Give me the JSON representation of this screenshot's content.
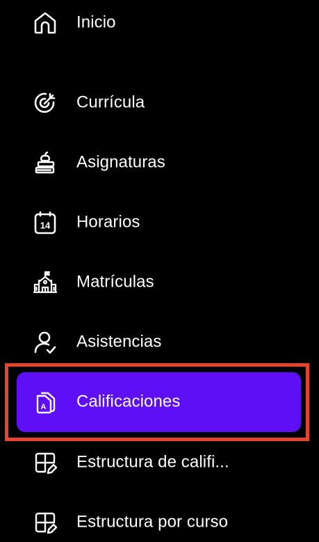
{
  "colors": {
    "background": "#000000",
    "active_item_bg": "#5f0ff5",
    "text": "#ffffff",
    "highlight_border": "#e8432c"
  },
  "sidebar": {
    "items": [
      {
        "label": "Inicio",
        "icon": "home-icon",
        "active": false
      },
      {
        "label": "Currícula",
        "icon": "target-icon",
        "active": false
      },
      {
        "label": "Asignaturas",
        "icon": "books-apple-icon",
        "active": false
      },
      {
        "label": "Horarios",
        "icon": "calendar-icon",
        "active": false,
        "icon_text": "14"
      },
      {
        "label": "Matrículas",
        "icon": "school-building-icon",
        "active": false
      },
      {
        "label": "Asistencias",
        "icon": "user-check-icon",
        "active": false
      },
      {
        "label": "Calificaciones",
        "icon": "grade-document-icon",
        "active": true,
        "icon_text": "A"
      },
      {
        "label": "Estructura de califi...",
        "icon": "grid-edit-icon",
        "active": false
      },
      {
        "label": "Estructura por curso",
        "icon": "grid-edit-icon",
        "active": false
      }
    ]
  }
}
